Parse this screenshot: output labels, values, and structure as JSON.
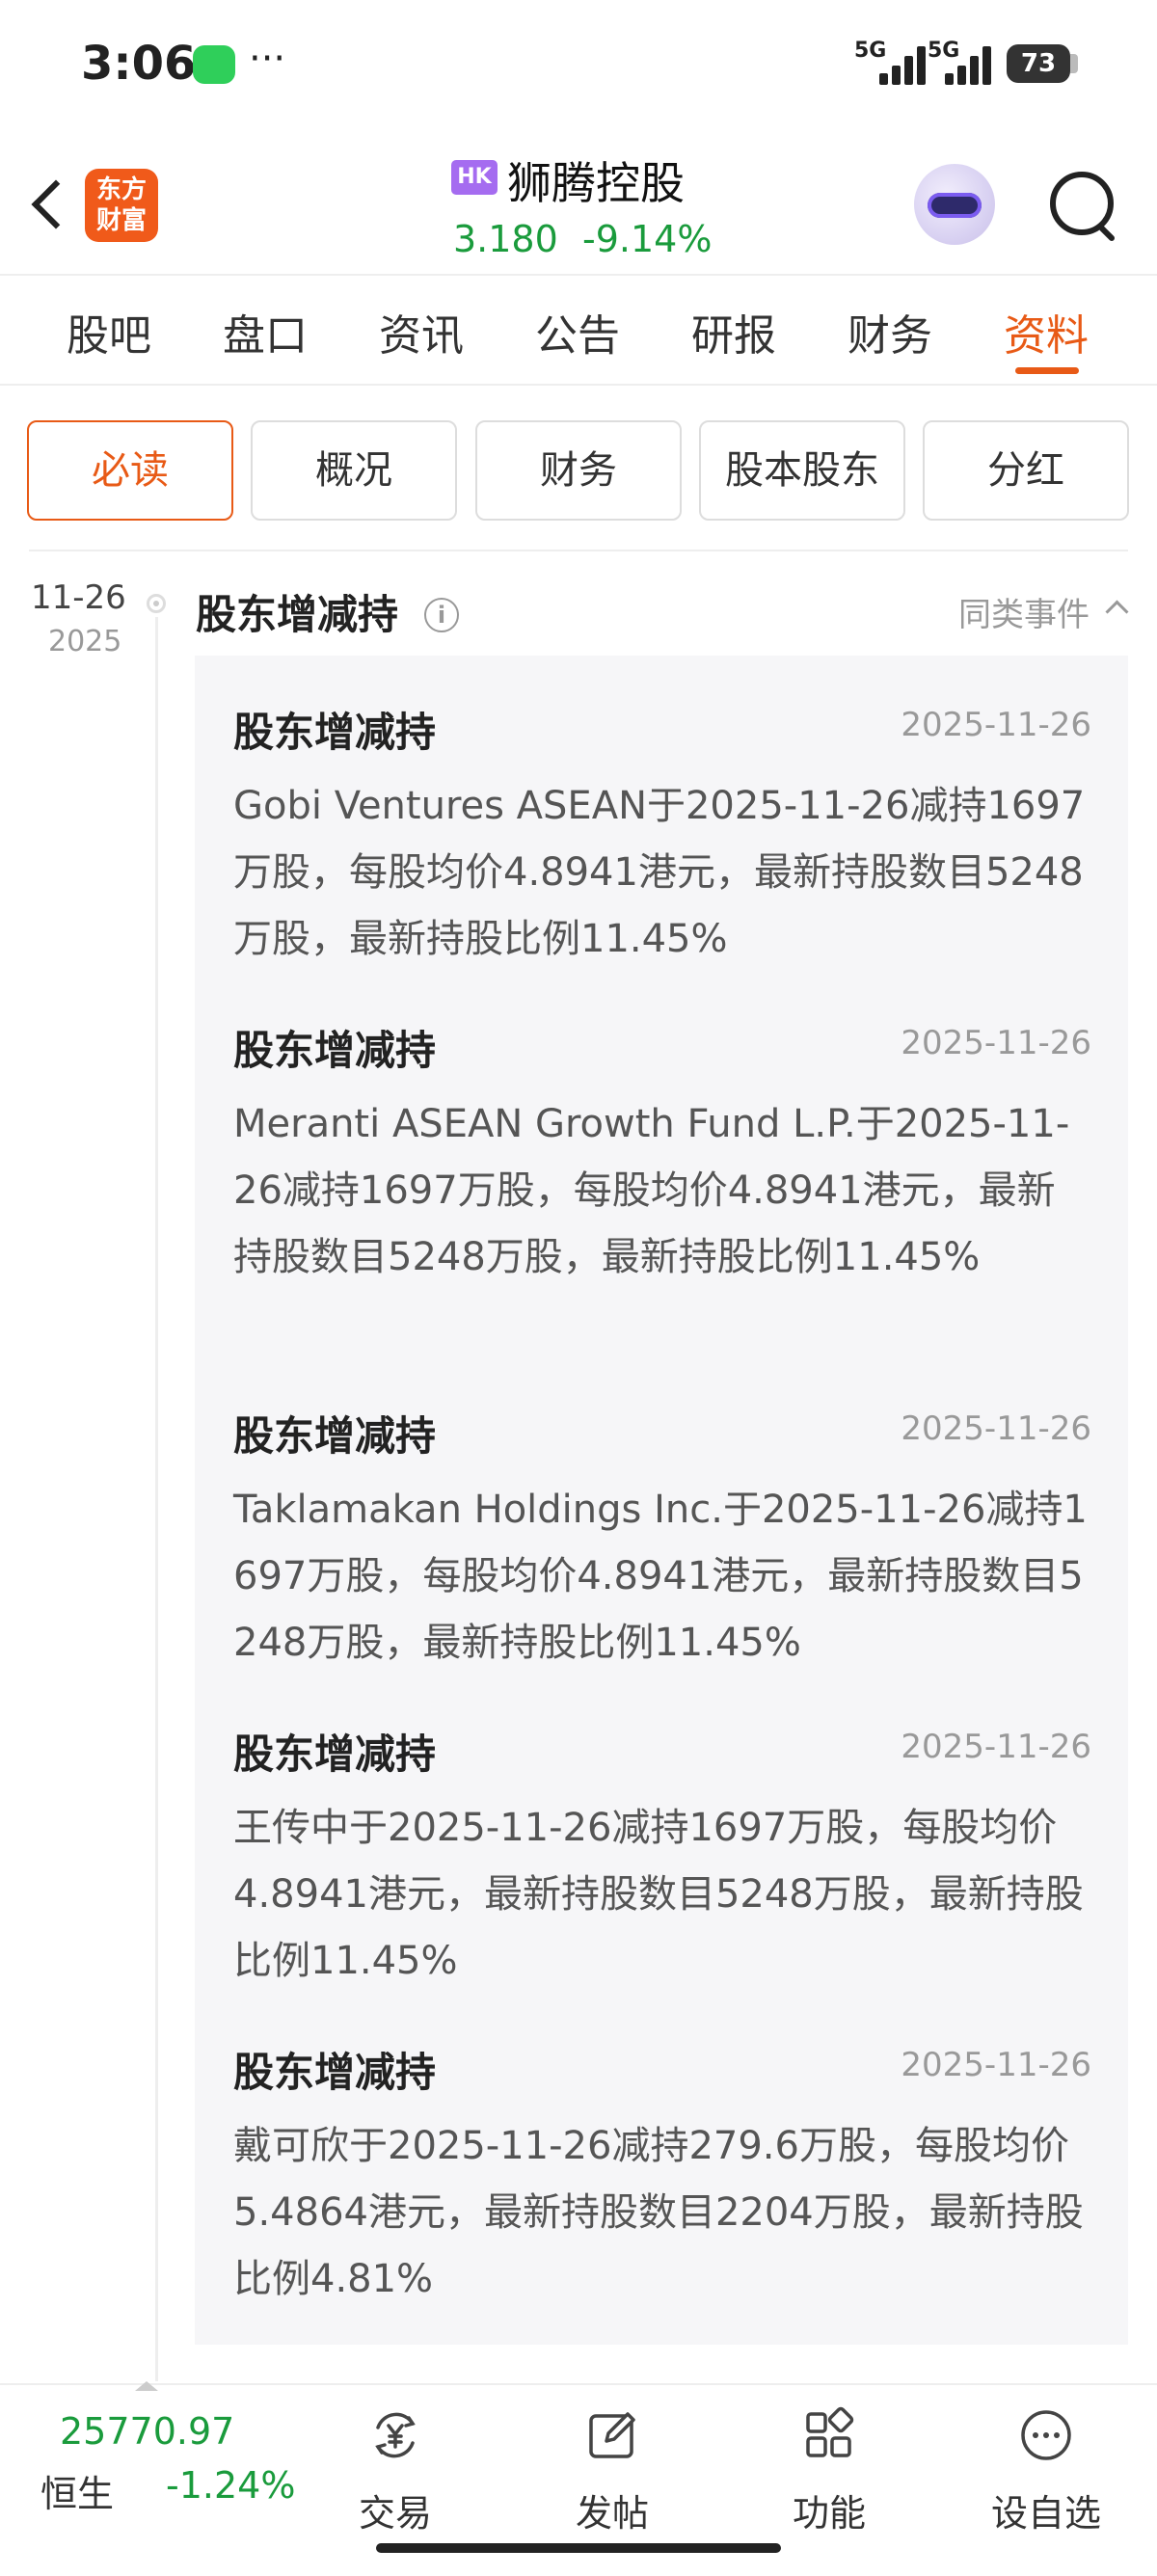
{
  "status_bar": {
    "time": "3:06",
    "more": "···",
    "signal_1": "5G",
    "signal_2": "5G",
    "battery": "73"
  },
  "header": {
    "app_logo": "东方\n财富",
    "market_badge": "HK",
    "stock_name": "狮腾控股",
    "price": "3.180",
    "change_pct": "-9.14%",
    "price_color": "#1a9b3c"
  },
  "tabs": {
    "items": [
      "股吧",
      "盘口",
      "资讯",
      "公告",
      "研报",
      "财务",
      "资料"
    ],
    "active_index": 6,
    "accent": "#e85a16"
  },
  "sub_tabs": {
    "items": [
      "必读",
      "概况",
      "财务",
      "股本股东",
      "分红"
    ],
    "active_index": 0
  },
  "timeline": {
    "date": "11-26",
    "year": "2025",
    "section_title": "股东增减持",
    "similar_events_label": "同类事件"
  },
  "events": [
    {
      "title": "股东增减持",
      "date": "2025-11-26",
      "body": "Gobi Ventures ASEAN于2025-11-26减持1697万股，每股均价4.8941港元，最新持股数目5248万股，最新持股比例11.45%"
    },
    {
      "title": "股东增减持",
      "date": "2025-11-26",
      "body": "Meranti ASEAN Growth Fund L.P.于2025-11-26减持1697万股，每股均价4.8941港元，最新持股数目5248万股，最新持股比例11.45%"
    },
    {
      "title": "股东增减持",
      "date": "2025-11-26",
      "body": "Taklamakan Holdings Inc.于2025-11-26减持1697万股，每股均价4.8941港元，最新持股数目5248万股，最新持股比例11.45%"
    },
    {
      "title": "股东增减持",
      "date": "2025-11-26",
      "body": "王传中于2025-11-26减持1697万股，每股均价4.8941港元，最新持股数目5248万股，最新持股比例11.45%"
    },
    {
      "title": "股东增减持",
      "date": "2025-11-26",
      "body": "戴可欣于2025-11-26减持279.6万股，每股均价5.4864港元，最新持股数目2204万股，最新持股比例4.81%"
    }
  ],
  "bottom_bar": {
    "index_value": "25770.97",
    "index_name": "恒生",
    "index_change": "-1.24%",
    "nav": [
      {
        "label": "交易",
        "icon": "yen-exchange-icon"
      },
      {
        "label": "发帖",
        "icon": "edit-post-icon"
      },
      {
        "label": "功能",
        "icon": "grid-apps-icon"
      },
      {
        "label": "设自选",
        "icon": "more-circle-icon"
      }
    ]
  }
}
